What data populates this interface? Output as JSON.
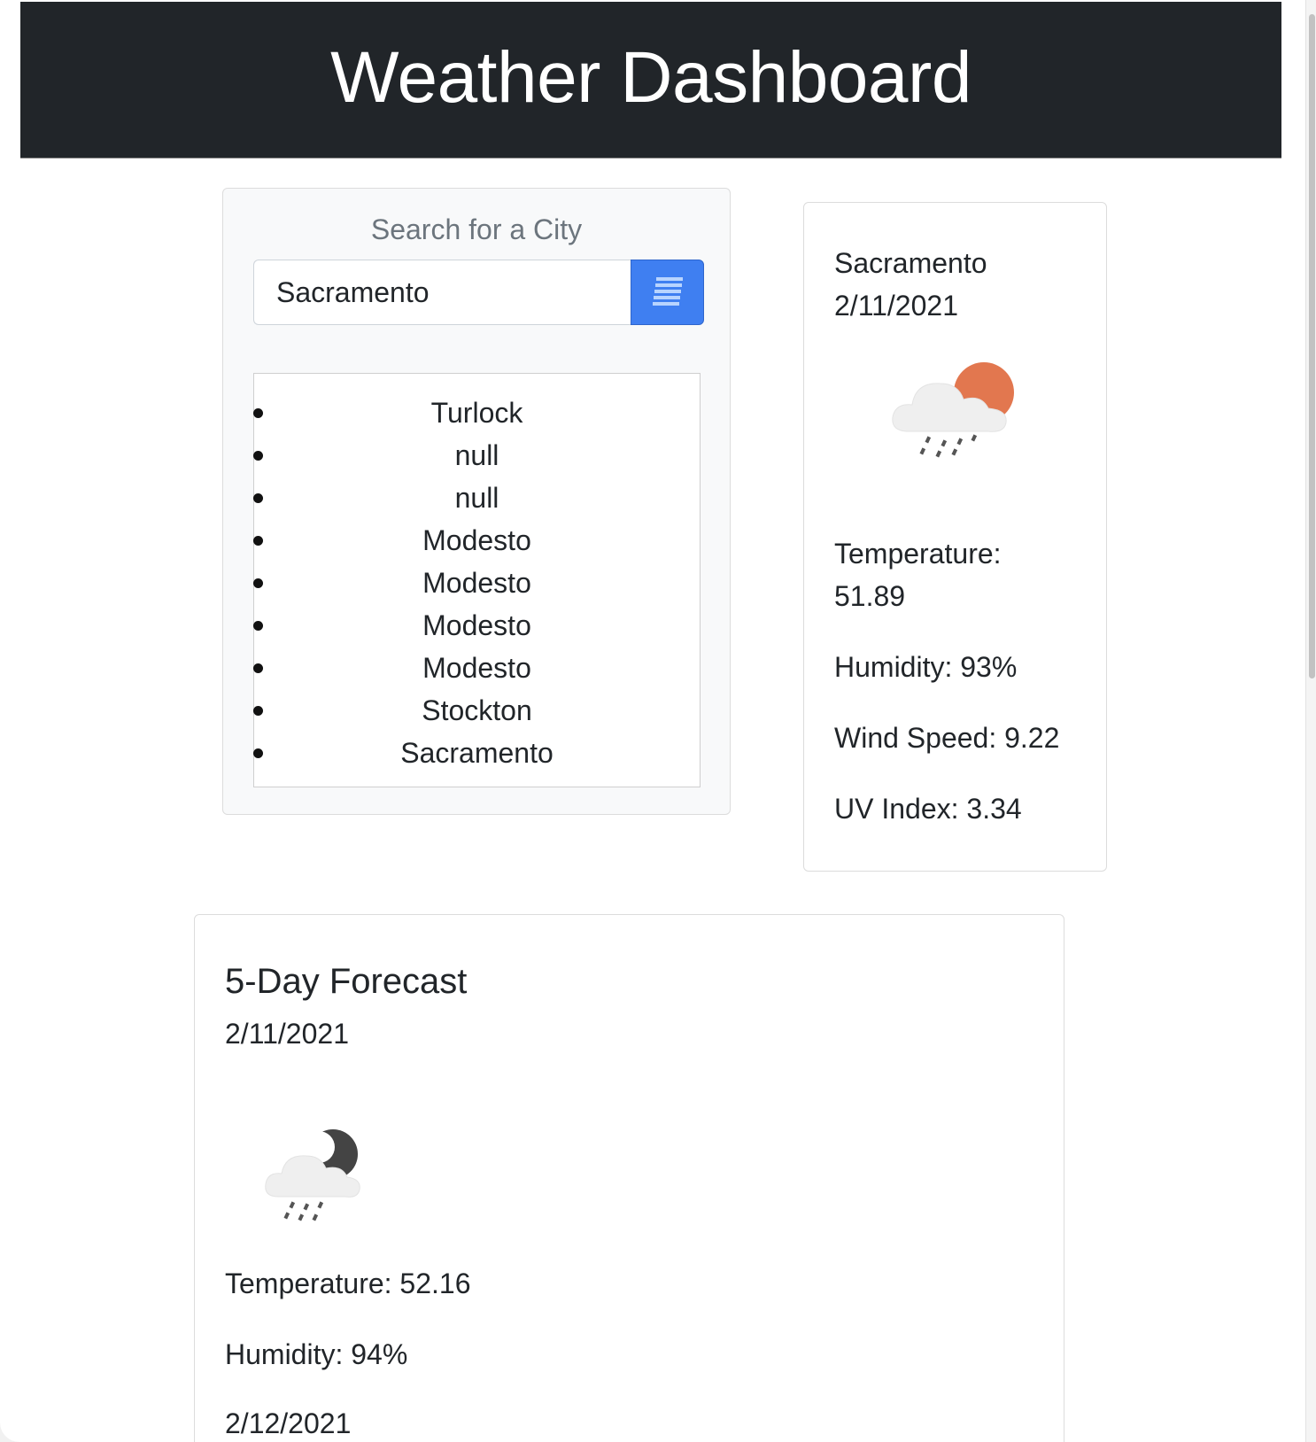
{
  "header": {
    "title": "Weather Dashboard"
  },
  "search": {
    "title": "Search for a City",
    "input_value": "Sacramento",
    "button_icon": "list-icon",
    "history": [
      "Turlock",
      "null",
      "null",
      "Modesto",
      "Modesto",
      "Modesto",
      "Modesto",
      "Stockton",
      "Sacramento"
    ]
  },
  "current": {
    "city": "Sacramento",
    "date": "2/11/2021",
    "icon": "rain-sun-icon",
    "temperature_label": "Temperature:",
    "temperature_value": "51.89",
    "humidity": "Humidity: 93%",
    "wind": "Wind Speed: 9.22",
    "uv": "UV Index: 3.34"
  },
  "forecast": {
    "title": "5-Day Forecast",
    "days": [
      {
        "date": "2/11/2021",
        "icon": "rain-moon-icon",
        "temperature": "Temperature: 52.16",
        "humidity": "Humidity: 94%"
      },
      {
        "date": "2/12/2021"
      }
    ]
  },
  "colors": {
    "header_bg": "#212529",
    "button_bg": "#3f7ff1",
    "sun": "#e2774f",
    "moon": "#444444",
    "cloud": "#f0f0f0"
  }
}
